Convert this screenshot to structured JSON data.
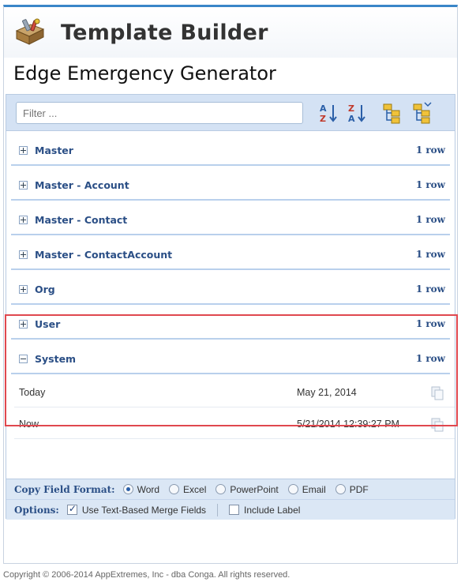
{
  "app": {
    "title": "Template Builder",
    "subtitle": "Edge Emergency Generator"
  },
  "filter": {
    "placeholder": "Filter ..."
  },
  "toolbar": {
    "buttons": [
      "sort-ascending-icon",
      "sort-descending-icon",
      "expand-all-icon",
      "collapse-all-icon"
    ]
  },
  "groups": [
    {
      "name": "Master",
      "count": "1 row",
      "expanded": false
    },
    {
      "name": "Master - Account",
      "count": "1 row",
      "expanded": false
    },
    {
      "name": "Master - Contact",
      "count": "1 row",
      "expanded": false
    },
    {
      "name": "Master - ContactAccount",
      "count": "1 row",
      "expanded": false
    },
    {
      "name": "Org",
      "count": "1 row",
      "expanded": false
    },
    {
      "name": "User",
      "count": "1 row",
      "expanded": false
    },
    {
      "name": "System",
      "count": "1 row",
      "expanded": true
    }
  ],
  "system_fields": [
    {
      "name": "Today",
      "value": "May 21, 2014"
    },
    {
      "name": "Now",
      "value": "5/21/2014 12:39:27 PM"
    }
  ],
  "copy_format": {
    "label": "Copy Field Format:",
    "options": [
      "Word",
      "Excel",
      "PowerPoint",
      "Email",
      "PDF"
    ],
    "selected": "Word"
  },
  "options": {
    "label": "Options:",
    "use_text_merge": {
      "label": "Use Text-Based Merge Fields",
      "checked": true
    },
    "include_label": {
      "label": "Include Label",
      "checked": false
    }
  },
  "copyright": "Copyright © 2006-2014 AppExtremes, Inc - dba Conga. All rights reserved.",
  "colors": {
    "accent": "#2b4f86",
    "toolbar": "#d4e2f4",
    "highlight": "#e0484f"
  }
}
